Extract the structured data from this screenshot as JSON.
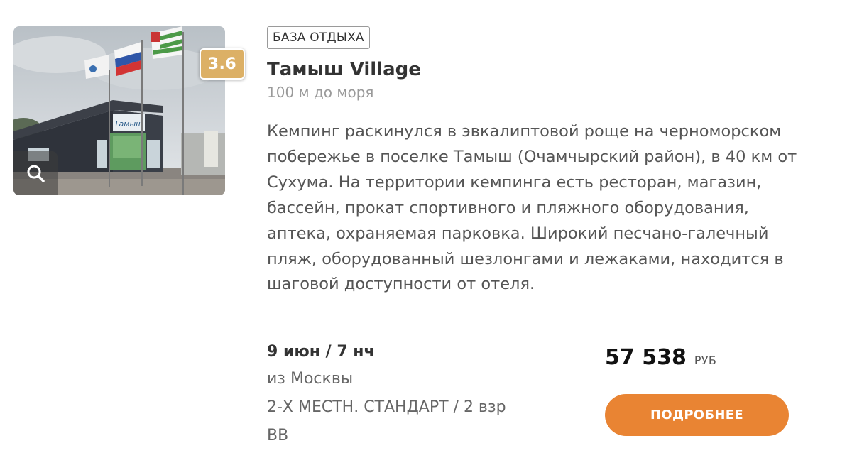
{
  "hotel": {
    "category": "БАЗА ОТДЫХА",
    "name": "Тамыш Village",
    "distance": "100 м до моря",
    "rating": "3.6",
    "description": "Кемпинг раскинулся в эвкалиптовой роще на черноморском побережье в поселке Тамыш (Очамчырский район), в 40 км от Сухума. На территории кемпинга есть ресторан, магазин, бассейн, прокат спортивного и пляжного оборудования, аптека, охраняемая парковка. Широкий песчано-галечный пляж, оборудованный шезлонгами и лежаками, находится в шаговой доступности от отеля.",
    "photo_sign": "Тамыш"
  },
  "tour": {
    "dates": "9 июн / 7 нч",
    "departure": "из Москвы",
    "room": "2-Х МЕСТН. СТАНДАРТ / 2 взр",
    "meal": "BB"
  },
  "price": {
    "amount": "57 538",
    "currency": "РУБ"
  },
  "actions": {
    "more_label": "ПОДРОБНЕЕ"
  },
  "colors": {
    "accent": "#e98433",
    "rating_badge": "#dcb066",
    "text_main": "#333333",
    "text_muted": "#9a9a9a"
  },
  "icons": {
    "zoom": "magnifier-icon"
  }
}
